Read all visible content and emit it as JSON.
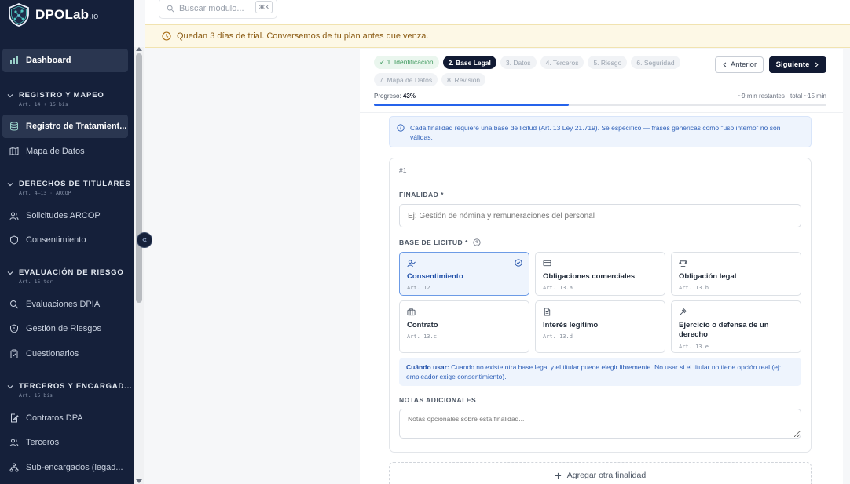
{
  "brand": {
    "name": "DPOLab",
    "suffix": ".io"
  },
  "search": {
    "placeholder": "Buscar módulo...",
    "shortcut": "⌘K"
  },
  "trial_banner": {
    "text": "Quedan 3 días de trial. Conversemos de tu plan antes que venza."
  },
  "sidebar": {
    "dashboard": "Dashboard",
    "sections": [
      {
        "title": "REGISTRO Y MAPEO",
        "sub": "Art. 14 + 15 bis",
        "items": [
          "Registro de Tratamient...",
          "Mapa de Datos"
        ]
      },
      {
        "title": "DERECHOS DE TITULARES",
        "sub": "Art. 4–13 · ARCOP",
        "items": [
          "Solicitudes ARCOP",
          "Consentimiento"
        ]
      },
      {
        "title": "EVALUACIÓN DE RIESGO",
        "sub": "Art. 15 ter",
        "items": [
          "Evaluaciones DPIA",
          "Gestión de Riesgos",
          "Cuestionarios"
        ]
      },
      {
        "title": "TERCEROS Y ENCARGAD...",
        "sub": "Art. 15 bis",
        "items": [
          "Contratos DPA",
          "Terceros",
          "Sub-encargados (legad..."
        ]
      }
    ]
  },
  "wizard": {
    "steps": [
      {
        "label": "✓ 1. Identificación",
        "state": "done"
      },
      {
        "label": "2. Base Legal",
        "state": "current"
      },
      {
        "label": "3. Datos",
        "state": "pending"
      },
      {
        "label": "4. Terceros",
        "state": "pending"
      },
      {
        "label": "5. Riesgo",
        "state": "pending"
      },
      {
        "label": "6. Seguridad",
        "state": "pending"
      },
      {
        "label": "7. Mapa de Datos",
        "state": "pending"
      },
      {
        "label": "8. Revisión",
        "state": "pending"
      }
    ],
    "prev_label": "Anterior",
    "next_label": "Siguiente",
    "progress_label": "Progreso:",
    "progress_value": "43%",
    "progress_fraction": 0.43,
    "time_text": "~9 min restantes · total ~15 min"
  },
  "info": {
    "text": "Cada finalidad requiere una base de licitud (Art. 13 Ley 21.719). Sé específico — frases genéricas como \"uso interno\" no son válidas."
  },
  "purpose": {
    "number": "#1",
    "finalidad_label": "FINALIDAD *",
    "finalidad_placeholder": "Ej: Gestión de nómina y remuneraciones del personal",
    "basis_label": "BASE DE LICITUD *",
    "bases": [
      {
        "title": "Consentimiento",
        "art": "Art. 12",
        "icon": "user-check-icon",
        "selected": true
      },
      {
        "title": "Obligaciones comerciales",
        "art": "Art. 13.a",
        "icon": "card-icon",
        "selected": false
      },
      {
        "title": "Obligación legal",
        "art": "Art. 13.b",
        "icon": "scale-icon",
        "selected": false
      },
      {
        "title": "Contrato",
        "art": "Art. 13.c",
        "icon": "briefcase-icon",
        "selected": false
      },
      {
        "title": "Interés legítimo",
        "art": "Art. 13.d",
        "icon": "document-icon",
        "selected": false
      },
      {
        "title": "Ejercicio o defensa de un derecho",
        "art": "Art. 13.e",
        "icon": "gavel-icon",
        "selected": false
      }
    ],
    "hint_bold": "Cuándo usar:",
    "hint_text": " Cuando no existe otra base legal y el titular puede elegir libremente. No usar si el titular no tiene opción real (ej: empleador exige consentimiento).",
    "notes_label": "NOTAS ADICIONALES",
    "notes_placeholder": "Notas opcionales sobre esta finalidad..."
  },
  "add_label": "Agregar otra finalidad",
  "colors": {
    "sidebar": "#15203a",
    "accent": "#2563eb",
    "primary": "#111a33",
    "trial_bg": "#fdf8e6"
  }
}
